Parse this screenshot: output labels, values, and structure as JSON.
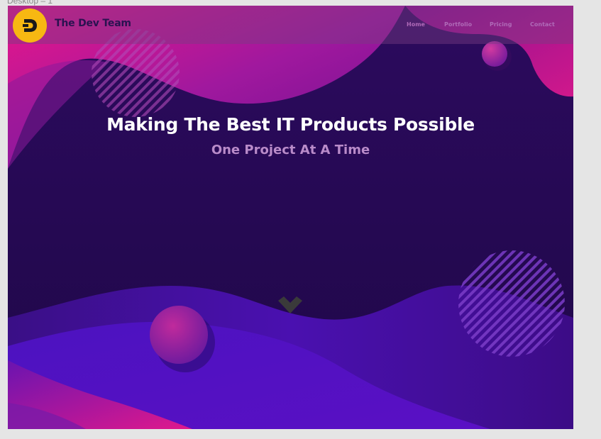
{
  "frame": {
    "label": "Desktop – 1"
  },
  "navbar": {
    "brand": "The Dev Team",
    "links": [
      "Home",
      "Portfolio",
      "Pricing",
      "Contact"
    ]
  },
  "hero": {
    "title": "Making The Best IT Products Possible",
    "subtitle": "One Project At A Time"
  },
  "colors": {
    "logo_badge": "#f7b812",
    "background_deep": "#2a0a5c",
    "magenta": "#e0158c",
    "violet": "#5a0fc0",
    "subtitle": "#b98bc9"
  },
  "icons": {
    "logo": "d-logo-icon",
    "scroll": "chevron-down-icon"
  }
}
